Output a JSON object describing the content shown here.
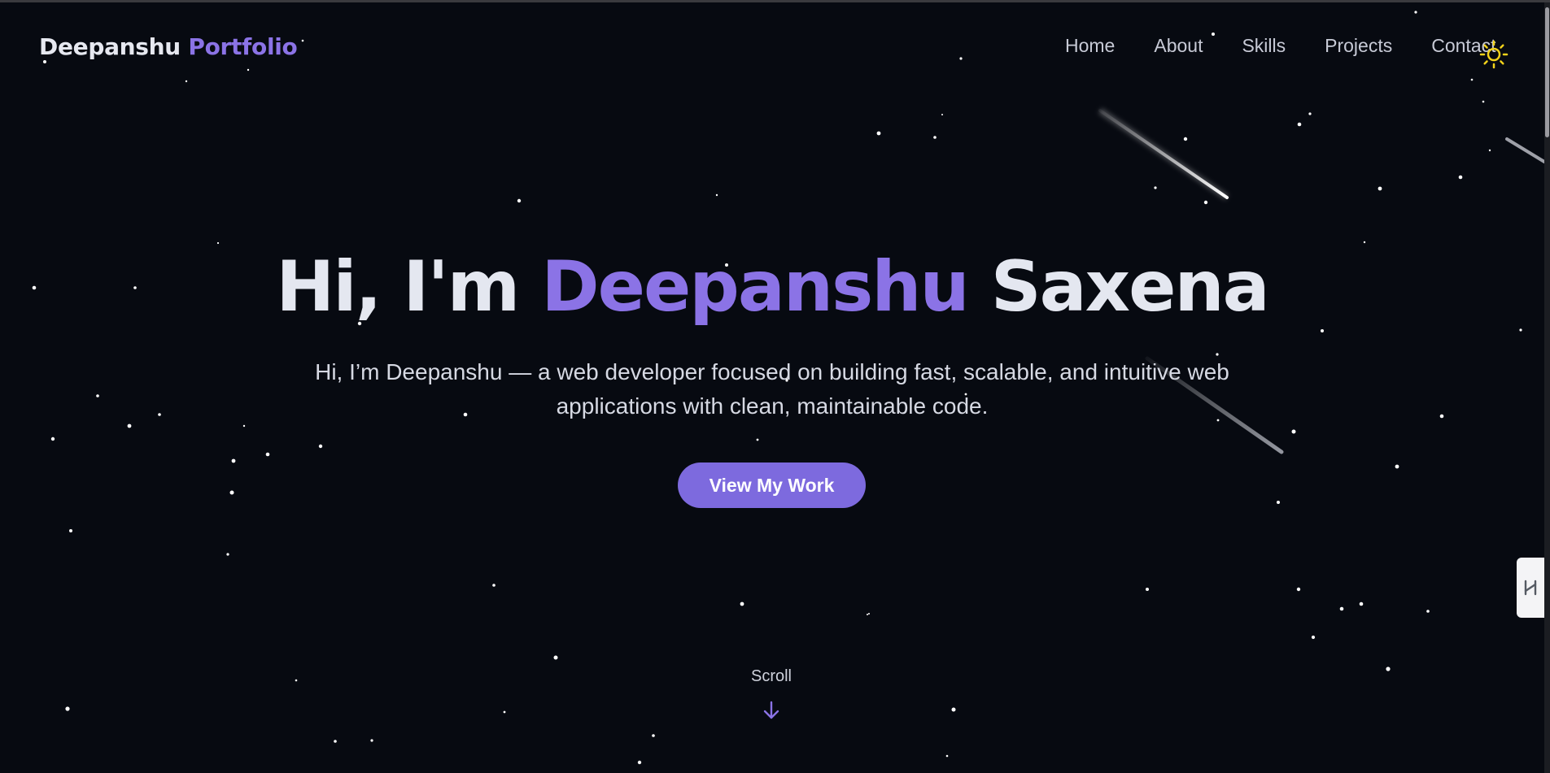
{
  "brand": {
    "first": "Deepanshu",
    "second": "Portfolio"
  },
  "nav": {
    "items": [
      {
        "label": "Home"
      },
      {
        "label": "About"
      },
      {
        "label": "Skills"
      },
      {
        "label": "Projects"
      },
      {
        "label": "Contact"
      }
    ],
    "theme_icon": "sun-icon"
  },
  "hero": {
    "greeting": "Hi, I'm",
    "first_name": "Deepanshu",
    "last_name": "Saxena",
    "subtitle": "Hi, I’m Deepanshu — a web developer focused on building fast, scalable, and intuitive web applications with clean, maintainable code.",
    "cta_label": "View My Work"
  },
  "scroll": {
    "label": "Scroll",
    "icon": "arrow-down-icon"
  },
  "side_tab": {
    "icon": "extension-handle-icon"
  },
  "colors": {
    "background": "#070a11",
    "accent": "#8b73e6",
    "button": "#7d6ade",
    "text": "#e4e7f0",
    "sun": "#f2d21b"
  }
}
